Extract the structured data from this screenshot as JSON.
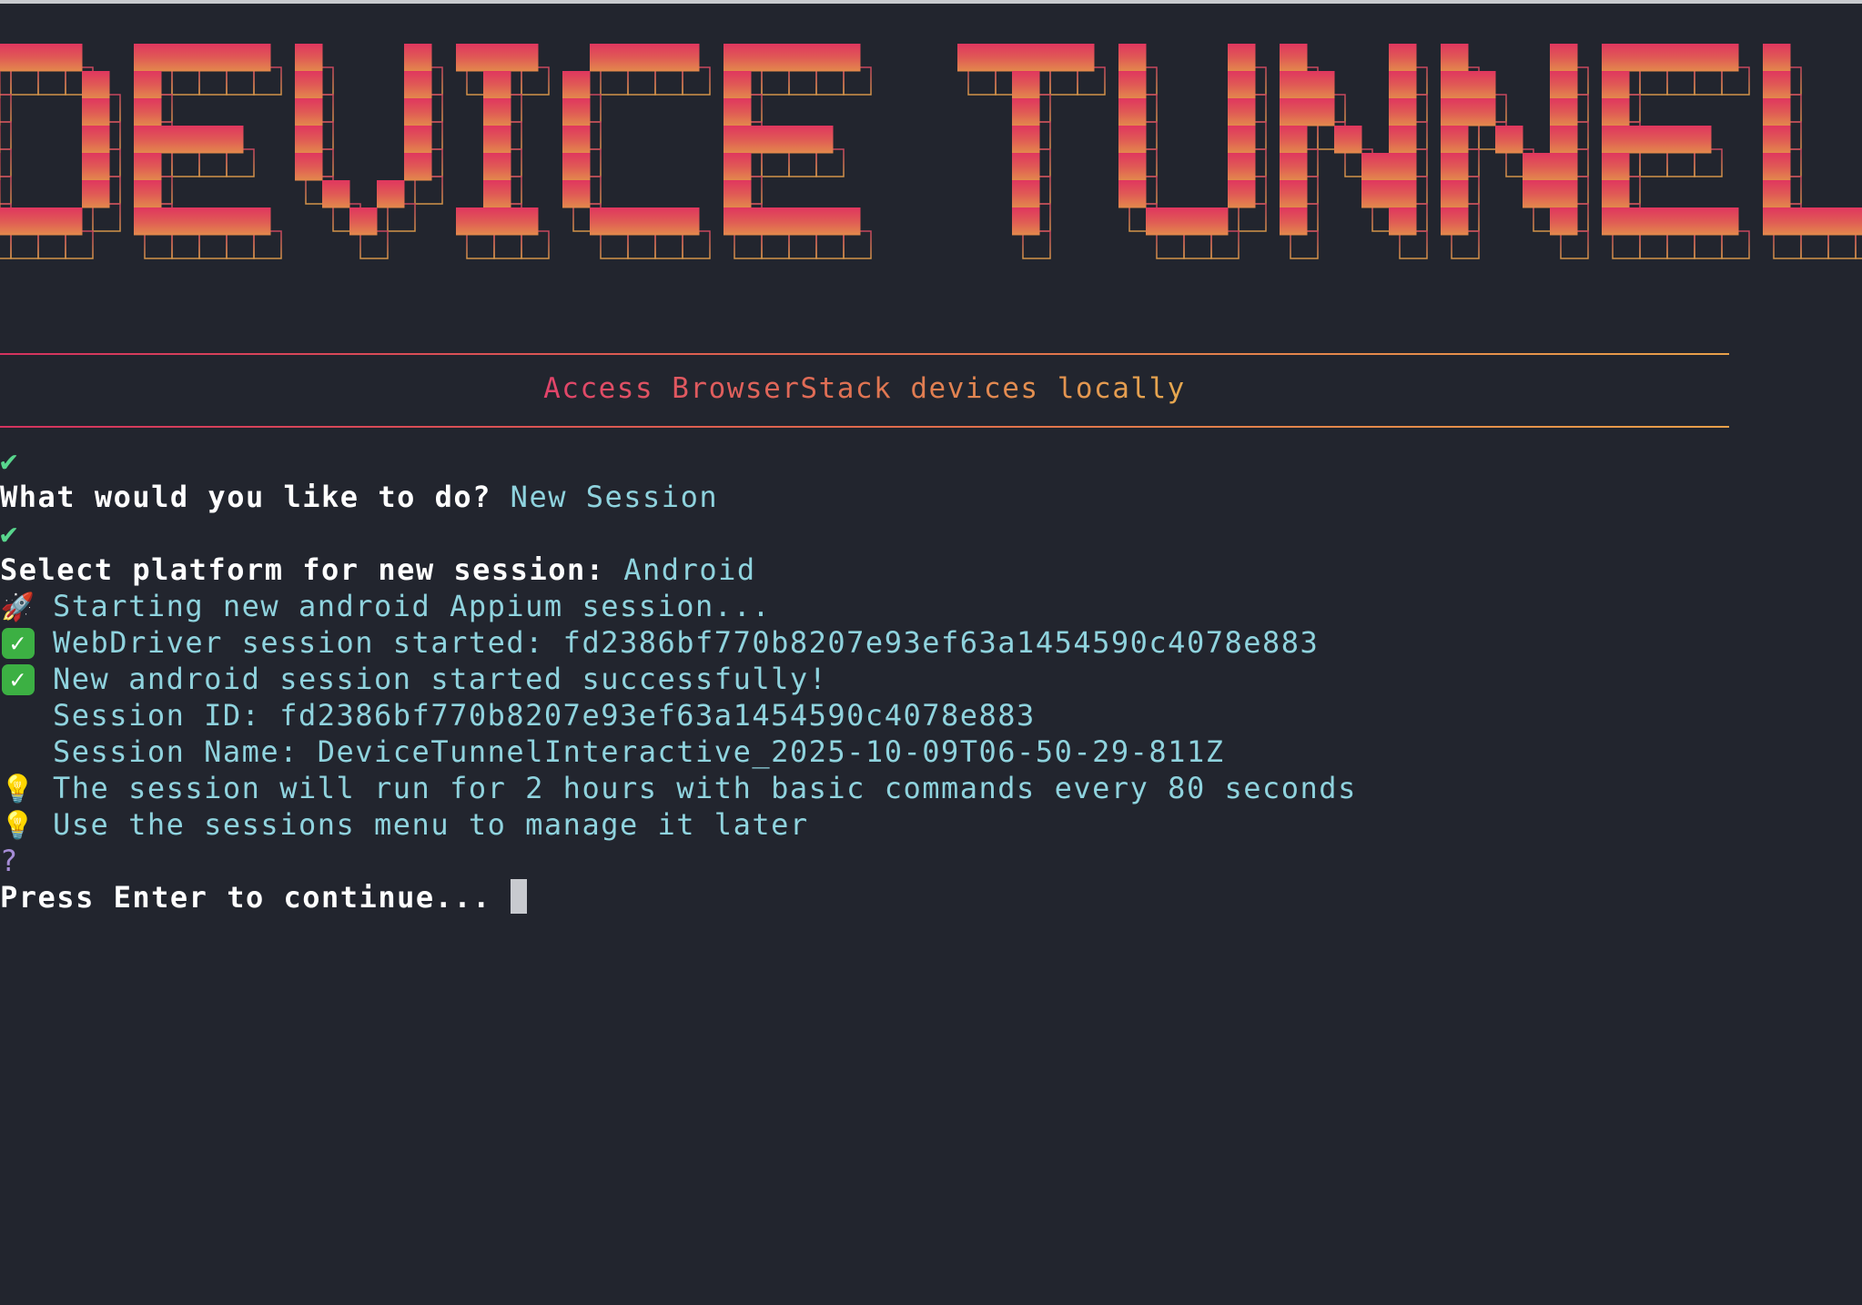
{
  "banner": {
    "title": "DEVICE TUNNEL",
    "subtitle": "Access BrowserStack devices locally"
  },
  "colors": {
    "background": "#22252e",
    "gradient_start": "#d4335f",
    "gradient_end": "#e8a04a",
    "prompt_text": "#ffffff",
    "answer_text": "#8fd3de",
    "check_mark": "#58d68d",
    "question_mark": "#a58cd6"
  },
  "prompts": [
    {
      "marker": "✔",
      "question": "What would you like to do?",
      "answer": "New Session"
    },
    {
      "marker": "✔",
      "question": "Select platform for new session:",
      "answer": "Android"
    }
  ],
  "log": {
    "starting": {
      "icon": "rocket-icon",
      "text": "Starting new android Appium session..."
    },
    "webdriver": {
      "icon": "check-box-icon",
      "text": "WebDriver session started: fd2386bf770b8207e93ef63a1454590c4078e883"
    },
    "success": {
      "icon": "check-box-icon",
      "text": "New android session started successfully!"
    },
    "session_id": "Session ID: fd2386bf770b8207e93ef63a1454590c4078e883",
    "session_name": "Session Name: DeviceTunnelInteractive_2025-10-09T06-50-29-811Z",
    "tip1": {
      "icon": "lightbulb-icon",
      "text": "The session will run for 2 hours with basic commands every 80 seconds"
    },
    "tip2": {
      "icon": "lightbulb-icon",
      "text": "Use the sessions menu to manage it later"
    }
  },
  "continue_prompt": {
    "marker": "?",
    "text": "Press Enter to continue..."
  }
}
